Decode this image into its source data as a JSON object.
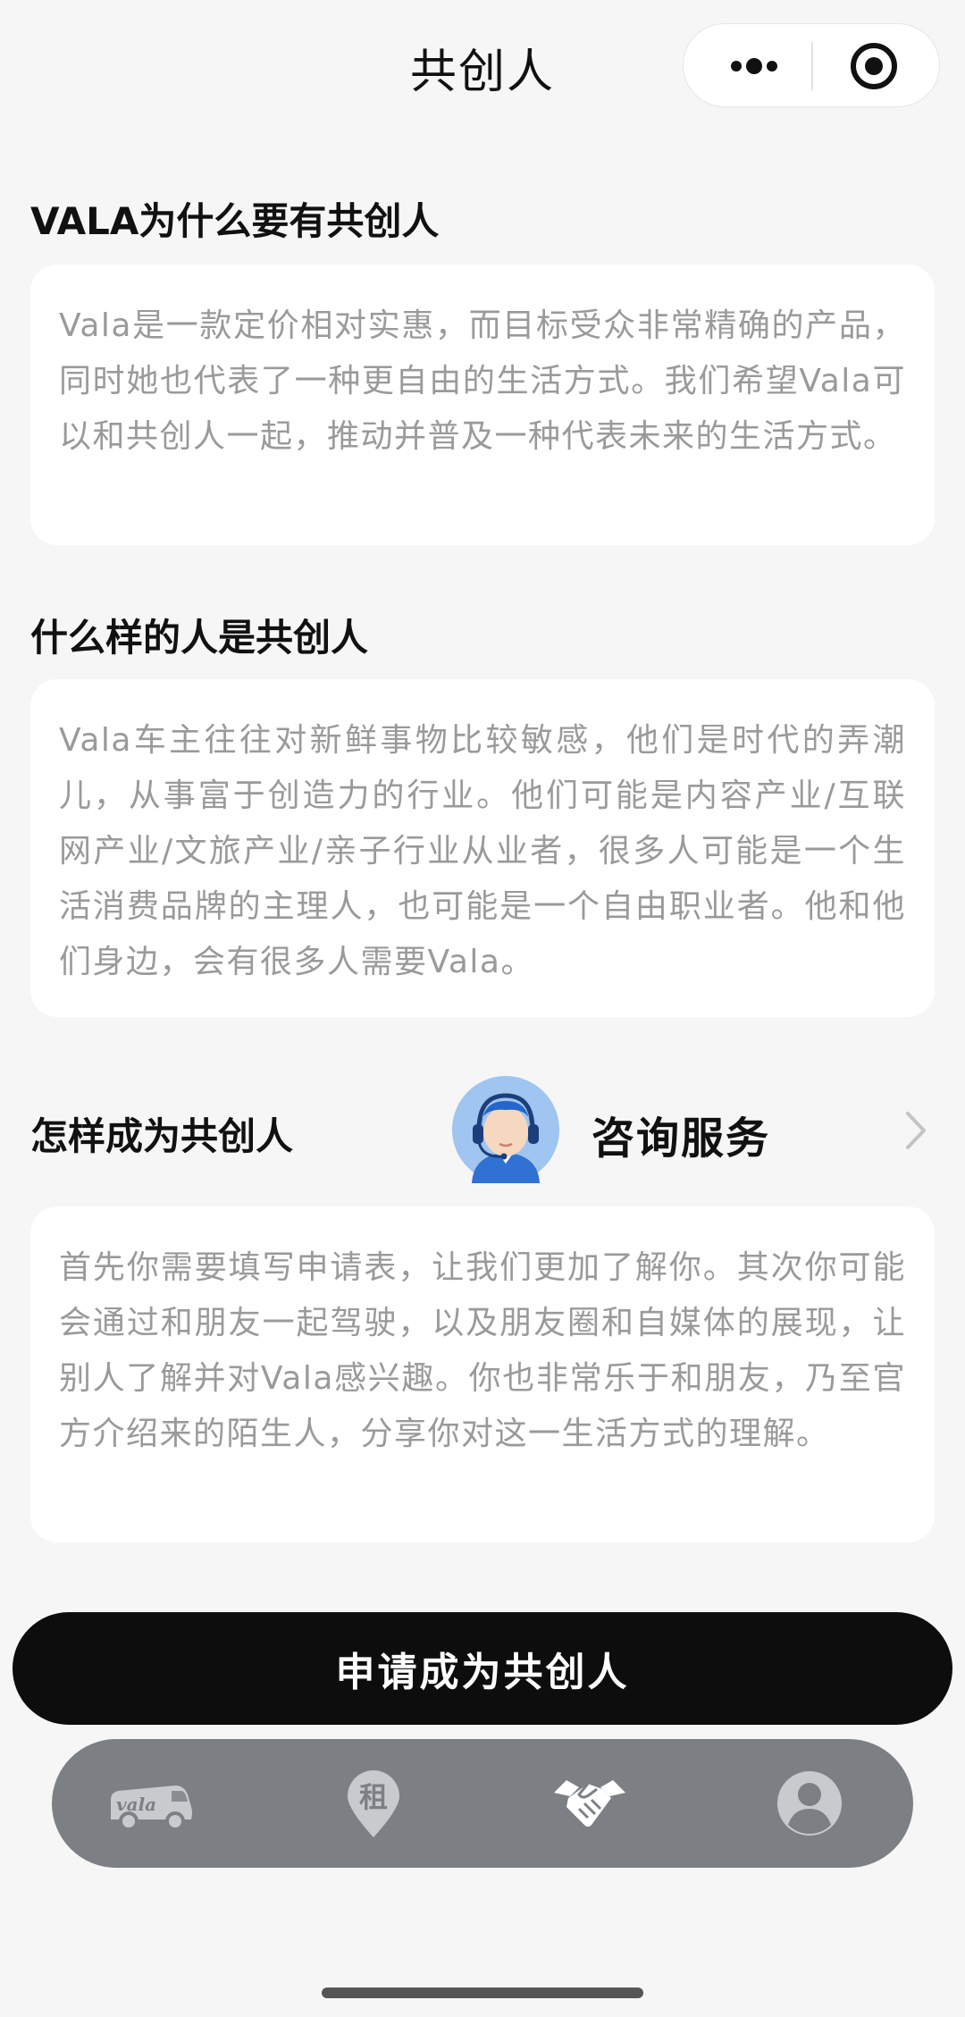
{
  "header": {
    "title": "共创人"
  },
  "sections": [
    {
      "title": "VALA为什么要有共创人",
      "body": "Vala是一款定价相对实惠，而目标受众非常精确的产品，同时她也代表了一种更自由的生活方式。我们希望Vala可以和共创人一起，推动并普及一种代表未来的生活方式。"
    },
    {
      "title": "什么样的人是共创人",
      "body": "Vala车主往往对新鲜事物比较敏感，他们是时代的弄潮儿，从事富于创造力的行业。他们可能是内容产业/互联网产业/文旅产业/亲子行业从业者，很多人可能是一个生活消费品牌的主理人，也可能是一个自由职业者。他和他们身边，会有很多人需要Vala。"
    },
    {
      "title": "怎样成为共创人",
      "body": "首先你需要填写申请表，让我们更加了解你。其次你可能会通过和朋友一起驾驶，以及朋友圈和自媒体的展现，让别人了解并对Vala感兴趣。你也非常乐于和朋友，乃至官方介绍来的陌生人，分享你对这一生活方式的理解。"
    }
  ],
  "consult": {
    "label": "咨询服务"
  },
  "apply_button": "申请成为共创人",
  "tabbar": {
    "items": [
      {
        "name": "vala",
        "icon": "van-icon",
        "logo_text": "vala",
        "active": false
      },
      {
        "name": "rent",
        "icon": "rent-pin-icon",
        "logo_text": "租",
        "active": false
      },
      {
        "name": "co-creator",
        "icon": "handshake-icon",
        "active": true
      },
      {
        "name": "profile",
        "icon": "user-icon",
        "active": false
      }
    ]
  },
  "colors": {
    "button": "#0d0d0d",
    "tabbar": "#7c8084",
    "body_text": "#9a9a9a",
    "background": "#f6f6f7"
  }
}
